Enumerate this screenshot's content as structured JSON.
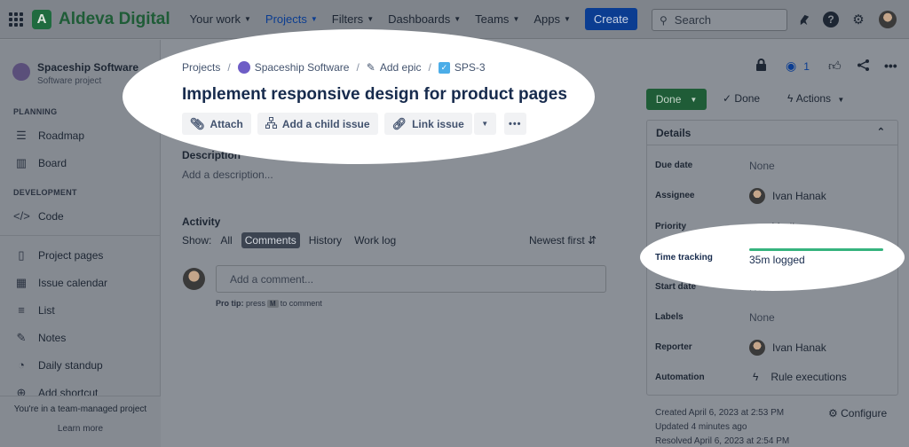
{
  "brand": {
    "name": "Aldeva Digital",
    "logo_letter": "A"
  },
  "nav": {
    "items": [
      "Your work",
      "Projects",
      "Filters",
      "Dashboards",
      "Teams",
      "Apps"
    ],
    "active": "Projects",
    "create_label": "Create"
  },
  "search": {
    "placeholder": "Search"
  },
  "project": {
    "name": "Spaceship Software",
    "type": "Software project"
  },
  "sidebar": {
    "planning_heading": "PLANNING",
    "planning": [
      {
        "label": "Roadmap",
        "icon": "roadmap-icon"
      },
      {
        "label": "Board",
        "icon": "board-icon"
      }
    ],
    "development_heading": "DEVELOPMENT",
    "development": [
      {
        "label": "Code",
        "icon": "code-icon"
      }
    ],
    "pages": [
      {
        "label": "Project pages",
        "icon": "page-icon"
      },
      {
        "label": "Issue calendar",
        "icon": "calendar-icon"
      },
      {
        "label": "List",
        "icon": "list-icon"
      },
      {
        "label": "Notes",
        "icon": "notes-icon"
      },
      {
        "label": "Daily standup",
        "icon": "standup-icon"
      },
      {
        "label": "Add shortcut",
        "icon": "shortcut-icon"
      }
    ],
    "footer_text": "You're in a team-managed project",
    "footer_link": "Learn more"
  },
  "breadcrumb": {
    "projects": "Projects",
    "project": "Spaceship Software",
    "epic": "Add epic",
    "issue_key": "SPS-3"
  },
  "issue": {
    "title": "Implement responsive design for product pages",
    "toolbar": {
      "attach": "Attach",
      "child": "Add a child issue",
      "link": "Link issue"
    },
    "description_heading": "Description",
    "description_placeholder": "Add a description..."
  },
  "activity": {
    "heading": "Activity",
    "show_label": "Show:",
    "filters": [
      "All",
      "Comments",
      "History",
      "Work log"
    ],
    "selected_filter": "Comments",
    "sort": "Newest first",
    "comment_placeholder": "Add a comment...",
    "protip_prefix": "Pro tip:",
    "protip_press": "press",
    "protip_key": "M",
    "protip_suffix": "to comment"
  },
  "header_actions": {
    "watchers": "1"
  },
  "status": {
    "button": "Done",
    "resolution": "Done",
    "actions": "Actions"
  },
  "details": {
    "heading": "Details",
    "rows": {
      "due_date": {
        "label": "Due date",
        "value": "None"
      },
      "assignee": {
        "label": "Assignee",
        "value": "Ivan Hanak"
      },
      "priority": {
        "label": "Priority",
        "value": "Medium"
      },
      "time_tracking": {
        "label": "Time tracking",
        "value": "35m logged",
        "progress": 1.0
      },
      "start_date": {
        "label": "Start date",
        "value": "None"
      },
      "labels": {
        "label": "Labels",
        "value": "None"
      },
      "reporter": {
        "label": "Reporter",
        "value": "Ivan Hanak"
      },
      "automation": {
        "label": "Automation",
        "value": "Rule executions"
      }
    }
  },
  "meta": {
    "created": "Created April 6, 2023 at 2:53 PM",
    "updated": "Updated 4 minutes ago",
    "resolved": "Resolved April 6, 2023 at 2:54 PM",
    "configure": "Configure"
  },
  "colors": {
    "brand_green": "#1f6b3f",
    "primary_blue": "#0b3d91",
    "done_green": "#1f5c37",
    "progress_green": "#36b37e",
    "priority_yellow": "#ffab00"
  }
}
